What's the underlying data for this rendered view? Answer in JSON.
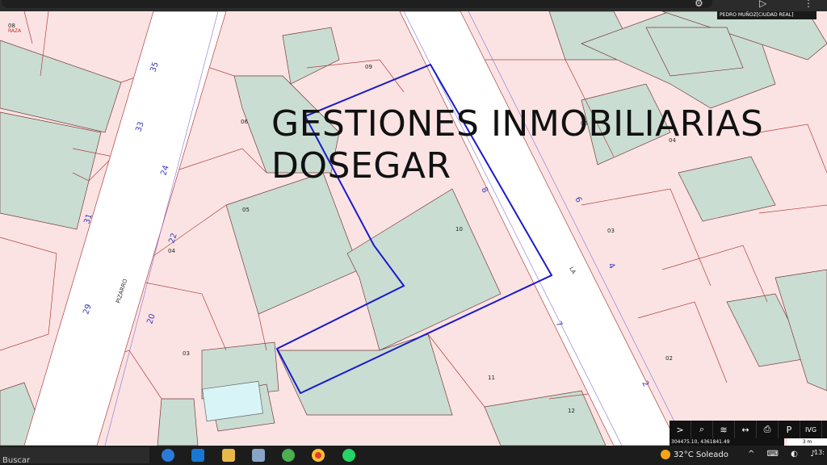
{
  "browser": {
    "menu_icon": "kebab-icon",
    "play_icon": "play-icon",
    "ext_icon": "gear-icon"
  },
  "overlay": {
    "line1": "GESTIONES INMOBILIARIAS",
    "line2": "DOSEGAR"
  },
  "map": {
    "municipality": "PEDRO MUÑOZ[CIUDAD REAL]",
    "street_name_left": "PIZARRO",
    "street_name_right": "LA",
    "parcels": [
      "09",
      "08",
      "06",
      "05",
      "04",
      "03",
      "10",
      "05",
      "04",
      "03",
      "02",
      "11",
      "12",
      "RAZA"
    ],
    "street_numbers_left": [
      "35",
      "33",
      "24",
      "31",
      "22",
      "29",
      "20"
    ],
    "street_numbers_right": [
      "6",
      "8",
      "4",
      "7",
      "2"
    ]
  },
  "toolbar": {
    "coords": "304475.10, 4361841.49",
    "scale": "3 m",
    "buttons": [
      {
        "icon": "chevron-right-icon",
        "glyph": ">"
      },
      {
        "icon": "search-icon",
        "glyph": "⌕"
      },
      {
        "icon": "layers-icon",
        "glyph": "≋"
      },
      {
        "icon": "measure-icon",
        "glyph": "↔"
      },
      {
        "icon": "print-icon",
        "glyph": "⎙"
      },
      {
        "icon": "parking-icon",
        "glyph": "P"
      },
      {
        "icon": "ivg-label",
        "glyph": "IVG"
      }
    ]
  },
  "taskbar": {
    "search_placeholder": "Buscar",
    "weather": "32°C  Soleado",
    "time": "13:"
  },
  "colors": {
    "green": "#c9ddd3",
    "pink": "#fbe3e3",
    "street": "#ffffff",
    "outline": "#1a1acc"
  }
}
